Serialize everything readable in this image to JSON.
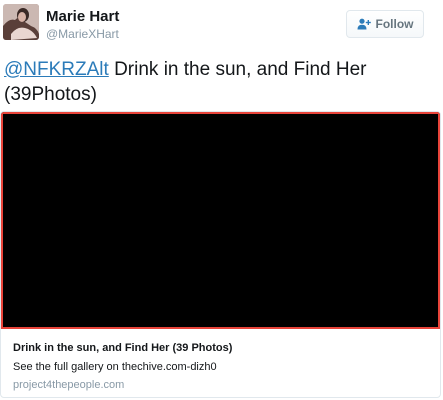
{
  "header": {
    "display_name": "Marie Hart",
    "handle": "@MarieXHart",
    "follow_label": "Follow",
    "follow_icon": "person-plus-icon",
    "accent_color": "#2b7bb9"
  },
  "tweet": {
    "mention": "@NFKRZAlt",
    "text": " Drink in the sun, and Find Her (39Photos)"
  },
  "card": {
    "title": "Drink in the sun, and Find Her (39 Photos)",
    "description": "See the full gallery on thechive.com-dizh0",
    "domain": "project4thepeople.com",
    "media_border_color": "#e8443a"
  }
}
